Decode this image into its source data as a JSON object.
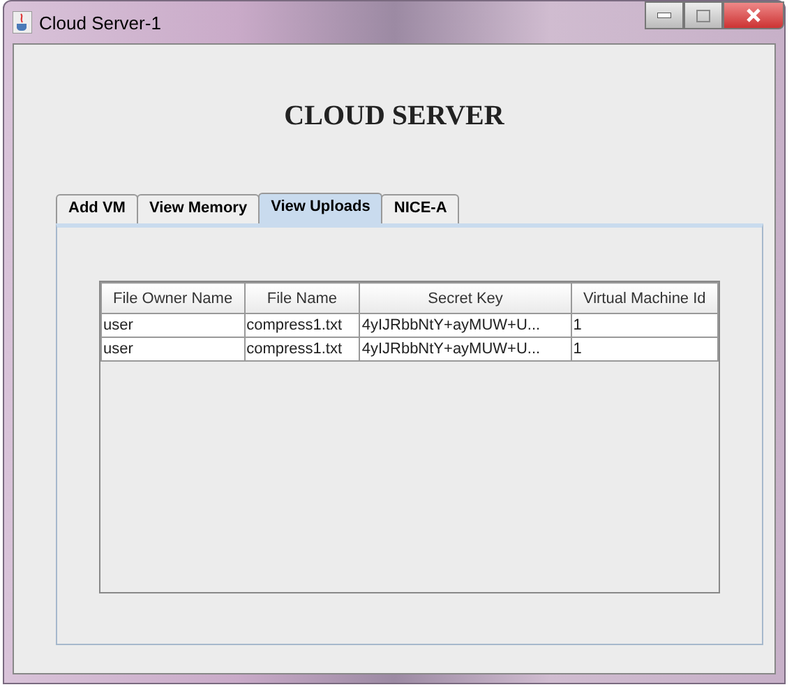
{
  "window": {
    "title": "Cloud Server-1"
  },
  "heading": "CLOUD SERVER",
  "tabs": [
    {
      "label": "Add VM",
      "selected": false
    },
    {
      "label": "View Memory",
      "selected": false
    },
    {
      "label": "View Uploads",
      "selected": true
    },
    {
      "label": "NICE-A",
      "selected": false
    }
  ],
  "table": {
    "columns": [
      "File Owner Name",
      "File Name",
      "Secret Key",
      "Virtual Machine Id"
    ],
    "rows": [
      [
        "user",
        "compress1.txt",
        "4yIJRbbNtY+ayMUW+U...",
        "1"
      ],
      [
        "user",
        "compress1.txt",
        "4yIJRbbNtY+ayMUW+U...",
        "1"
      ]
    ]
  }
}
